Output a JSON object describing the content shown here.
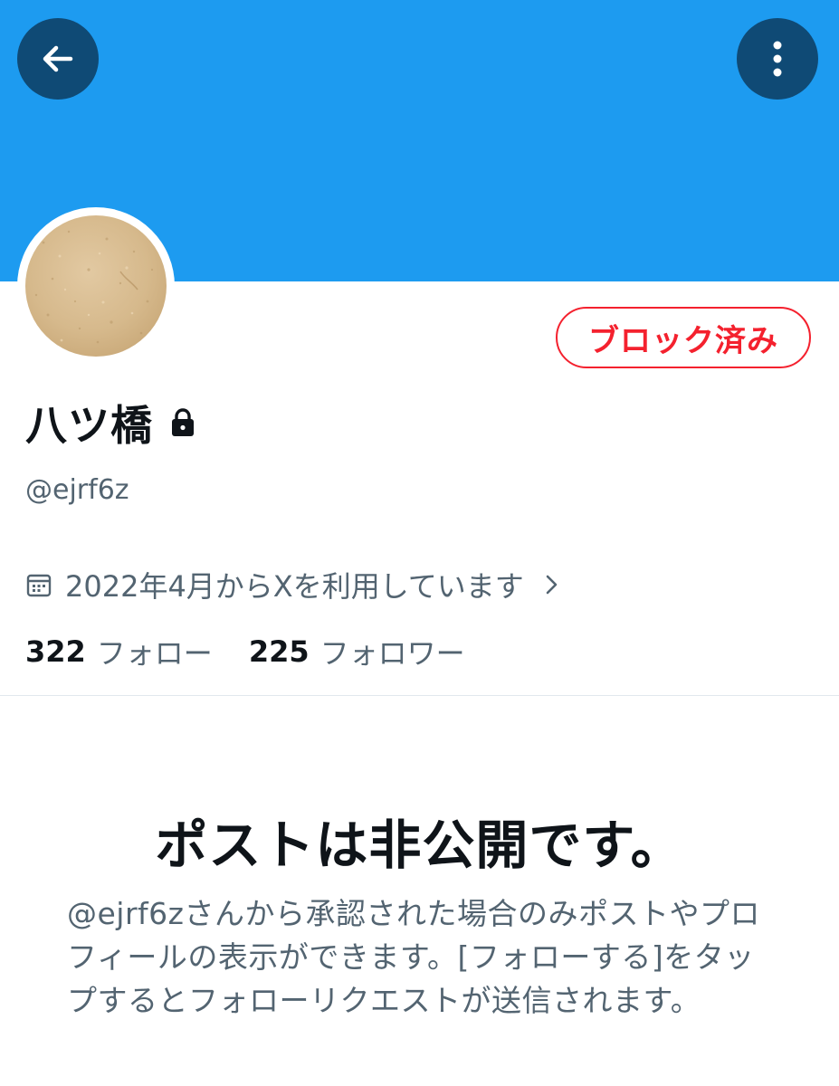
{
  "header": {
    "back_icon": "arrow-left-icon",
    "more_icon": "more-vertical-icon",
    "banner_color": "#1d9bf0"
  },
  "profile": {
    "block_button_label": "ブロック済み",
    "display_name": "八ツ橋",
    "handle": "@ejrf6z",
    "joined_text": "2022年4月からXを利用しています",
    "following_count": "322",
    "following_label": "フォロー",
    "followers_count": "225",
    "followers_label": "フォロワー"
  },
  "protected_notice": {
    "title": "ポストは非公開です。",
    "description": "@ejrf6zさんから承認された場合のみポストやプロフィールの表示ができます。[フォローする]をタップするとフォローリクエストが送信されます。"
  },
  "colors": {
    "accent": "#1d9bf0",
    "danger": "#f4212e",
    "secondary_text": "#536471",
    "primary_text": "#0f1419"
  }
}
